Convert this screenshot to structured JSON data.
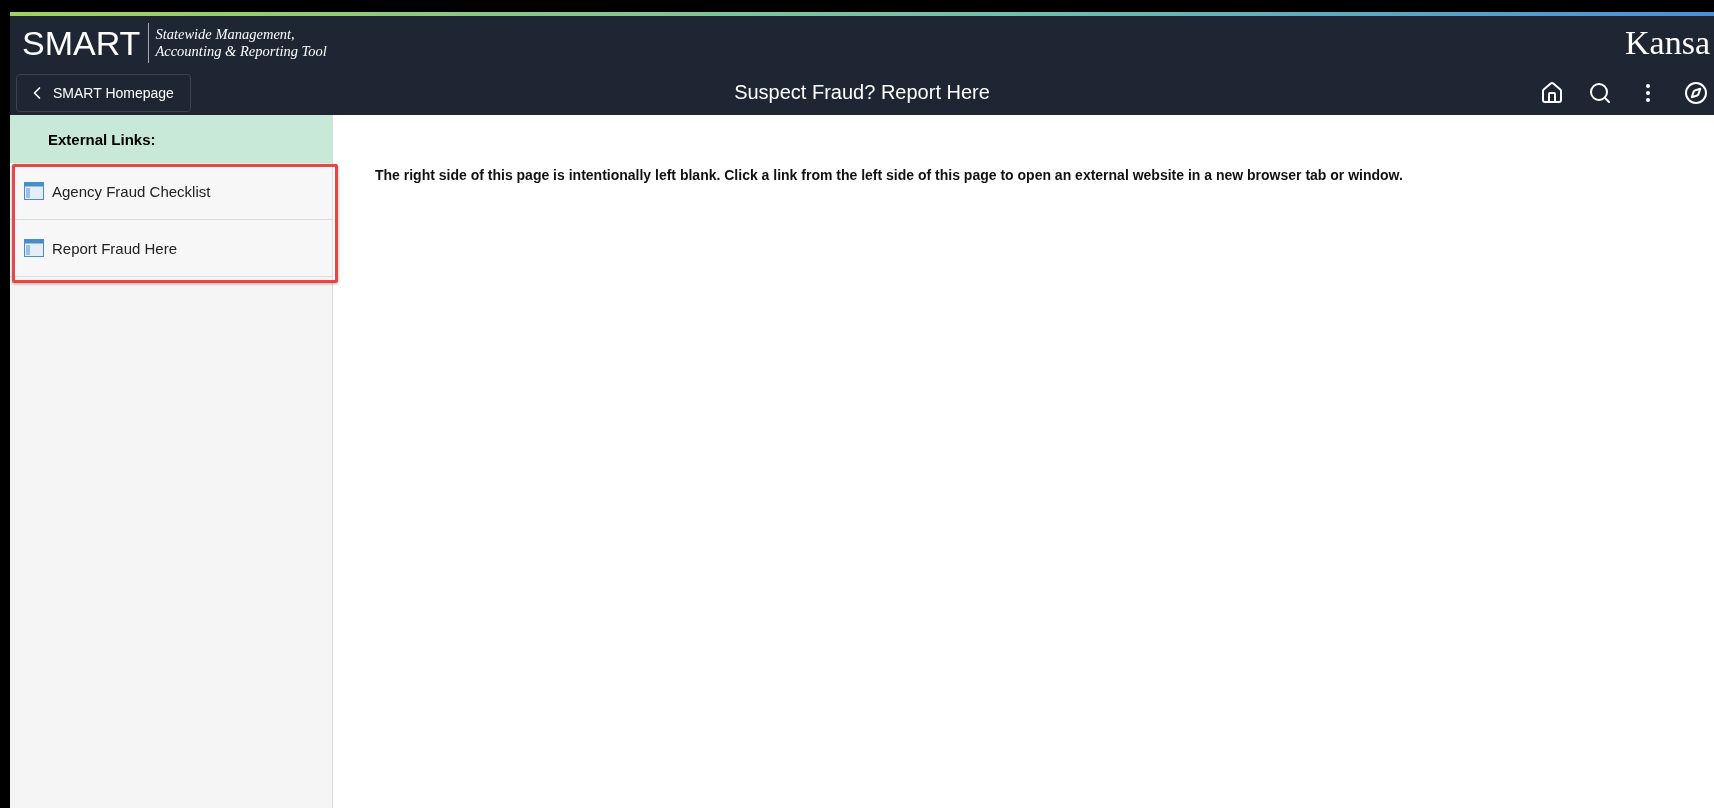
{
  "header": {
    "logo": "SMART",
    "tagline_lines": [
      "Statewide Management,",
      "Accounting & Reporting Tool"
    ],
    "state_logo": "Kansa",
    "back_button": "SMART Homepage",
    "title": "Suspect Fraud? Report Here"
  },
  "sidebar": {
    "heading": "External Links:",
    "items": [
      {
        "label": "Agency Fraud Checklist"
      },
      {
        "label": "Report Fraud Here"
      }
    ]
  },
  "content": {
    "message": "The right side of this page is intentionally left blank. Click a link from the left side of this page to open an external website in a new browser tab or window."
  }
}
